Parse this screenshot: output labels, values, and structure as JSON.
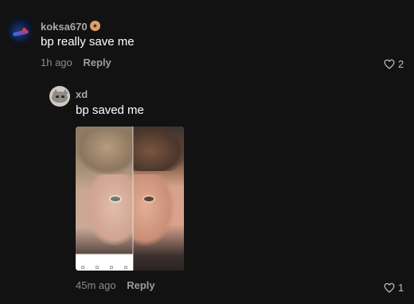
{
  "comment": {
    "username": "koksa670",
    "badge_icon": "cookie-emoji",
    "text": "bp really save me",
    "time": "1h ago",
    "reply_label": "Reply",
    "like_count": "2",
    "like_icon": "heart-outline-icon"
  },
  "reply": {
    "username": "xd",
    "text": "bp saved me",
    "image": "side-by-side face comparison photo",
    "time": "45m ago",
    "reply_label": "Reply",
    "like_count": "1",
    "like_icon": "heart-outline-icon"
  },
  "colors": {
    "background": "#121212",
    "username": "#a9a9a9",
    "meta": "#8a8a8a",
    "text": "#ffffff"
  }
}
